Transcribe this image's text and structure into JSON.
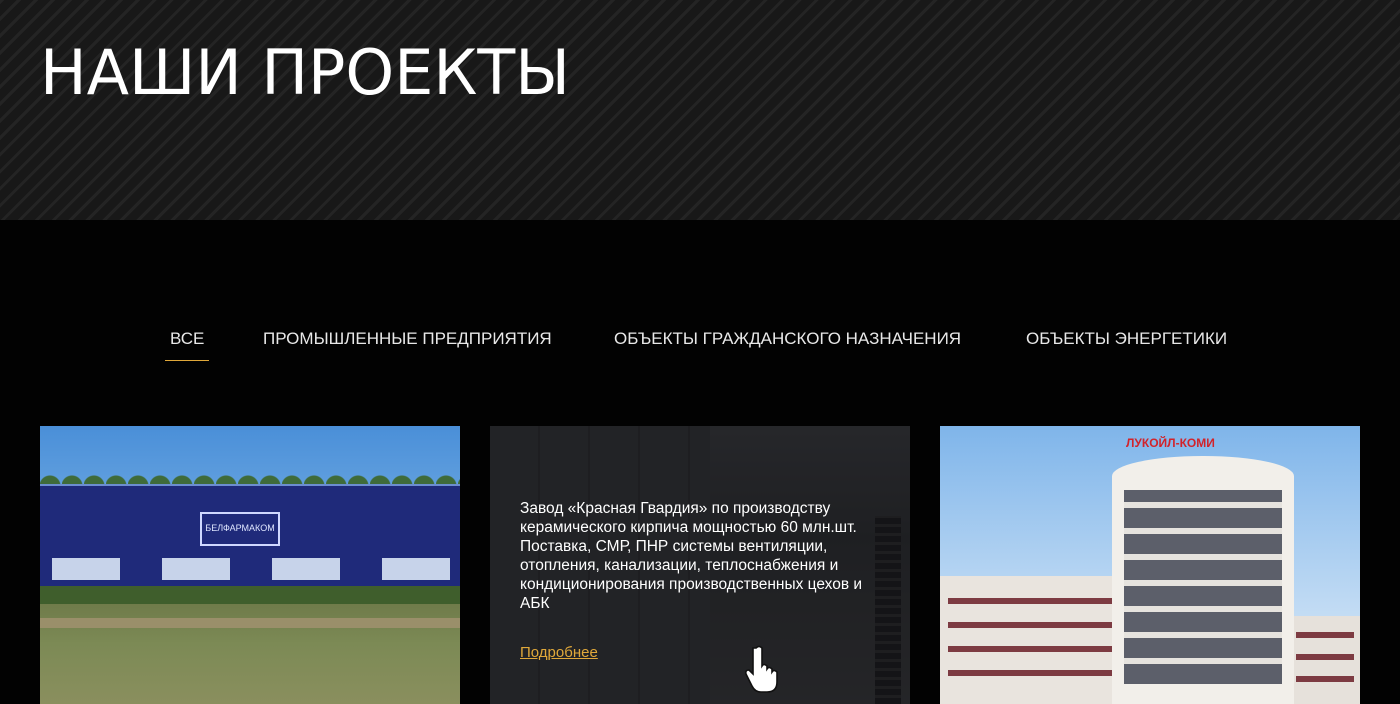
{
  "hero": {
    "title": "НАШИ ПРОЕКТЫ"
  },
  "filters": [
    {
      "label": "ВСЕ",
      "active": true
    },
    {
      "label": "ПРОМЫШЛЕННЫЕ ПРЕДПРИЯТИЯ",
      "active": false
    },
    {
      "label": "ОБЪЕКТЫ ГРАЖДАНСКОГО НАЗНАЧЕНИЯ",
      "active": false
    },
    {
      "label": "ОБЪЕКТЫ ЭНЕРГЕТИКИ",
      "active": false
    }
  ],
  "accent_color": "#e0a83a",
  "cards": [
    {
      "image_text": "БЕЛФАРМАКОМ"
    },
    {
      "description": "Завод «Красная Гвардия» по производству керамического кирпича мощностью 60 млн.шт. Поставка, СМР, ПНР системы вентиляции, отопления, канализации, теплоснабжения и кондиционирования производственных цехов и АБК",
      "more_label": "Подробнее"
    },
    {
      "image_text": "ЛУКОЙЛ-КОМИ"
    }
  ]
}
